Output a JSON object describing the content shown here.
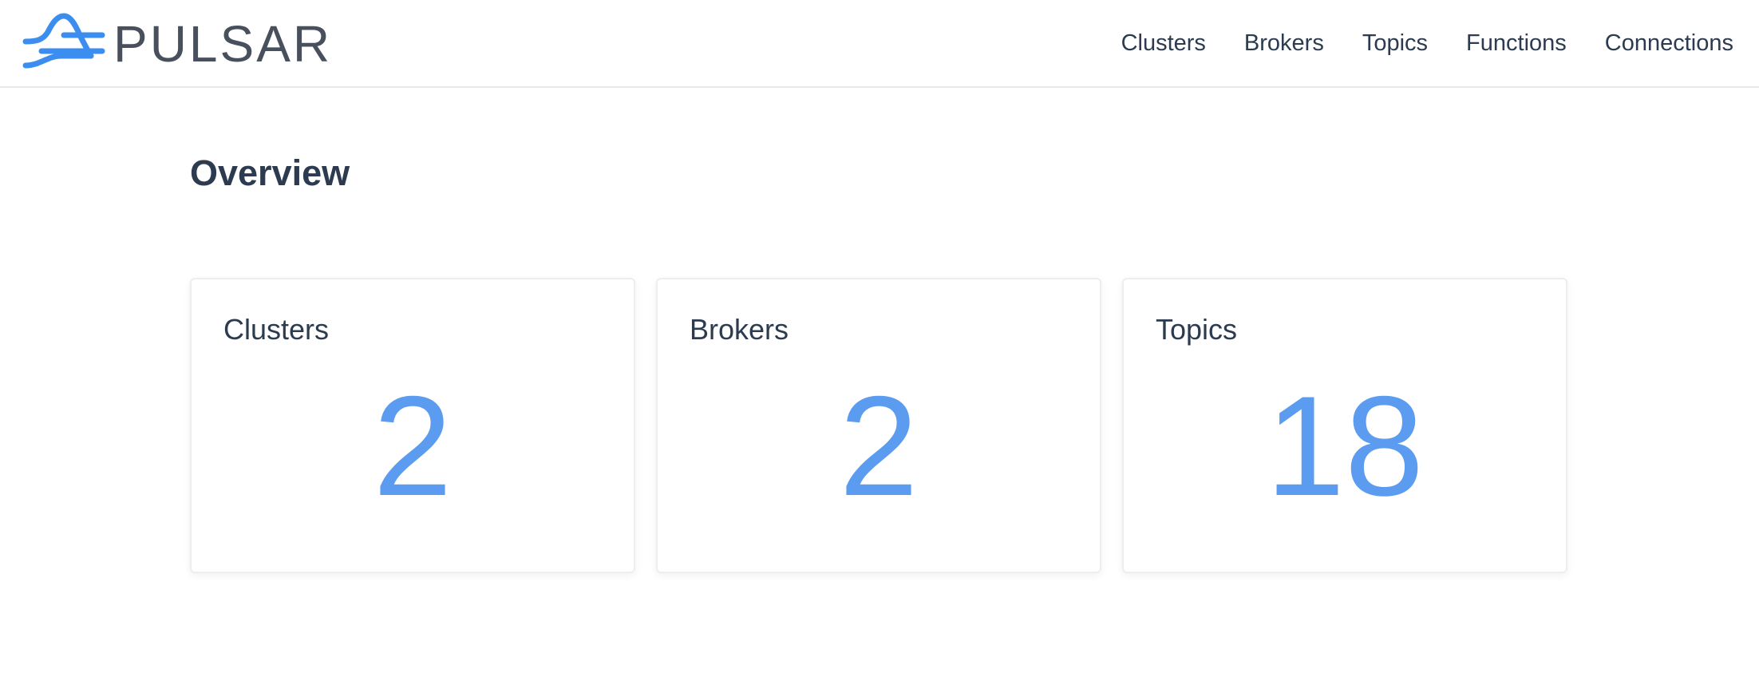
{
  "header": {
    "logo_text": "PULSAR",
    "logo_icon": "pulsar-wave-icon",
    "nav": [
      {
        "label": "Clusters"
      },
      {
        "label": "Brokers"
      },
      {
        "label": "Topics"
      },
      {
        "label": "Functions"
      },
      {
        "label": "Connections"
      }
    ]
  },
  "main": {
    "title": "Overview",
    "cards": [
      {
        "label": "Clusters",
        "value": "2"
      },
      {
        "label": "Brokers",
        "value": "2"
      },
      {
        "label": "Topics",
        "value": "18"
      }
    ]
  },
  "colors": {
    "accent": "#5b9cf0",
    "logo_blue": "#3b8ef0",
    "text": "#2c3b4f",
    "logo_text": "#47505c"
  }
}
